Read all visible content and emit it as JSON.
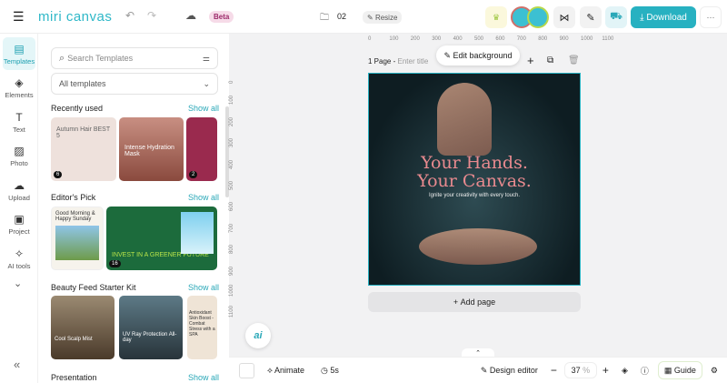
{
  "header": {
    "logo": "miri canvas",
    "beta": "Beta",
    "page_count": "02",
    "resize": "Resize",
    "download": "Download",
    "more": "···"
  },
  "nav": [
    {
      "label": "Templates",
      "icon": "▤"
    },
    {
      "label": "Elements",
      "icon": "◈"
    },
    {
      "label": "Text",
      "icon": "T"
    },
    {
      "label": "Photo",
      "icon": "▨"
    },
    {
      "label": "Upload",
      "icon": "☁"
    },
    {
      "label": "Project",
      "icon": "▣"
    },
    {
      "label": "AI tools",
      "icon": "✧"
    }
  ],
  "panel": {
    "search_placeholder": "Search Templates",
    "filter": "All templates",
    "sections": [
      {
        "title": "Recently used",
        "show": "Show all"
      },
      {
        "title": "Editor's Pick",
        "show": "Show all"
      },
      {
        "title": "Beauty Feed Starter Kit",
        "show": "Show all"
      },
      {
        "title": "Presentation",
        "show": "Show all"
      }
    ],
    "thumbs": {
      "t1": "Autumn Hair BEST 5",
      "t1b": "6",
      "t2": "Intense Hydration Mask",
      "t3b": "2",
      "e1": "Good Morning & Happy Sunday",
      "e2": "INVEST IN A GREENER FUTURE",
      "e2b": "16",
      "b1": "Cool Scalp Mist",
      "b2": "UV Ray Protection All-day",
      "b3": "Antioxidant Skin Boost - Combat Stress with a SPA"
    }
  },
  "ruler": {
    "top": [
      "0",
      "100",
      "200",
      "300",
      "400",
      "500",
      "600",
      "700",
      "800",
      "900",
      "1000",
      "1100"
    ],
    "left": [
      "0",
      "100",
      "200",
      "300",
      "400",
      "500",
      "600",
      "700",
      "800",
      "900",
      "1000",
      "1100"
    ]
  },
  "canvas": {
    "page_label": "1 Page -",
    "title_placeholder": "Enter title",
    "edit_bg": "Edit background",
    "headline1": "Your Hands.",
    "headline2": "Your Canvas.",
    "sub": "Ignite your creativity with every touch.",
    "add_page": "Add page",
    "ai": "ai"
  },
  "bottom": {
    "animate": "Animate",
    "duration": "5s",
    "design_editor": "Design editor",
    "zoom": "37",
    "zoom_unit": "%",
    "guide": "Guide"
  },
  "colors": {
    "accent": "#27b1c1",
    "headline": "#e98a8f"
  }
}
